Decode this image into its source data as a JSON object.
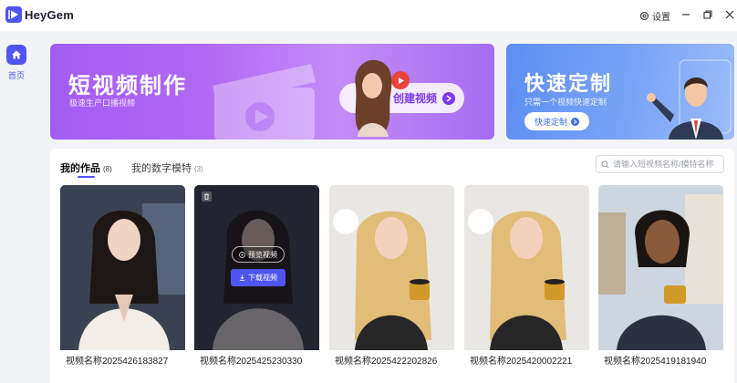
{
  "app": {
    "title": "HeyGem",
    "logo_icon": "heygem-logo-icon"
  },
  "titlebar": {
    "settings_label": "设置",
    "settings_icon": "gear-icon"
  },
  "sidebar": {
    "items": [
      {
        "label": "首页",
        "icon": "home-icon",
        "active": true
      }
    ]
  },
  "banners": {
    "short_video": {
      "title": "短视频制作",
      "subtitle": "极速生产口播视频",
      "button_label": "创建视频"
    },
    "quick_custom": {
      "title": "快速定制",
      "subtitle": "只需一个视频快速定制",
      "button_label": "快速定制"
    }
  },
  "works": {
    "tabs": [
      {
        "label": "我的作品",
        "count": "(8)",
        "active": true
      },
      {
        "label": "我的数字模特",
        "count": "(3)",
        "active": false
      }
    ],
    "search_placeholder": "请输入短视频名称/模特名称",
    "hover_actions": {
      "preview": "预览视频",
      "download": "下载视频"
    },
    "items": [
      {
        "name": "视频名称2025426183827"
      },
      {
        "name": "视频名称2025425230330"
      },
      {
        "name": "视频名称2025422202826"
      },
      {
        "name": "视频名称2025420002221"
      },
      {
        "name": "视频名称2025419181940"
      }
    ]
  },
  "colors": {
    "accent": "#4f55f0",
    "banner_purple": "#a35cf2",
    "banner_blue": "#5d8ef2"
  }
}
